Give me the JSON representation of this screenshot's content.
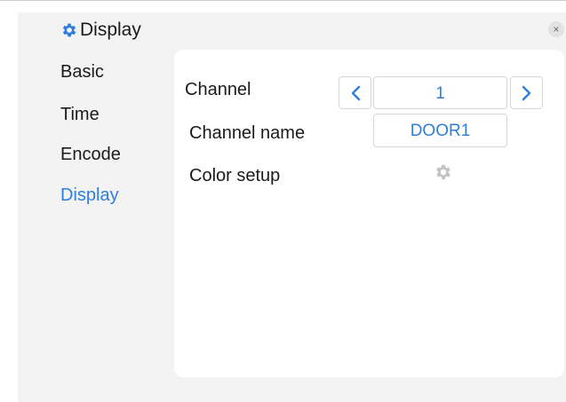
{
  "window": {
    "title": "Display",
    "title_icon": "gear-icon",
    "close_glyph": "×"
  },
  "sidebar": {
    "items": [
      {
        "label": "Basic",
        "active": false
      },
      {
        "label": "Time",
        "active": false
      },
      {
        "label": "Encode",
        "active": false
      },
      {
        "label": "Display",
        "active": true
      }
    ]
  },
  "panel": {
    "channel_label": "Channel",
    "channel_value": "1",
    "channel_name_label": "Channel name",
    "channel_name_value": "DOOR1",
    "color_setup_label": "Color setup"
  },
  "colors": {
    "accent": "#2f7ddd",
    "background": "#f3f3f3",
    "panel": "#ffffff"
  }
}
